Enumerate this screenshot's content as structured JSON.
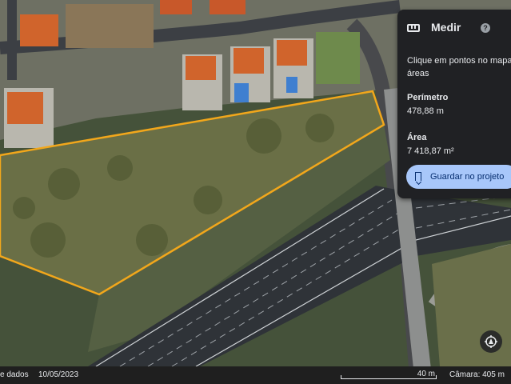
{
  "measure_panel": {
    "title": "Medir",
    "help_icon": "?",
    "instruction": "Clique em pontos no mapa para medir distâncias ou áreas",
    "instruction_visible": "Clique em pontos no mapa",
    "instruction_line2": "áreas",
    "perimeter_label": "Perímetro",
    "perimeter_value": "478,88 m",
    "area_label": "Área",
    "area_value": "7 418,87 m²",
    "save_button": "Guardar no projeto"
  },
  "bottom_bar": {
    "attribution": "e dados",
    "date": "10/05/2023",
    "scale_label": "40 m",
    "camera": "Câmara: 405 m"
  },
  "colors": {
    "panel_bg": "#202124",
    "button_bg": "#a8c7fa",
    "polygon_stroke": "#f2a71b",
    "road": "#2f3338"
  },
  "icons": [
    "ruler-icon",
    "help-icon",
    "bookmark-icon",
    "compass-icon"
  ]
}
